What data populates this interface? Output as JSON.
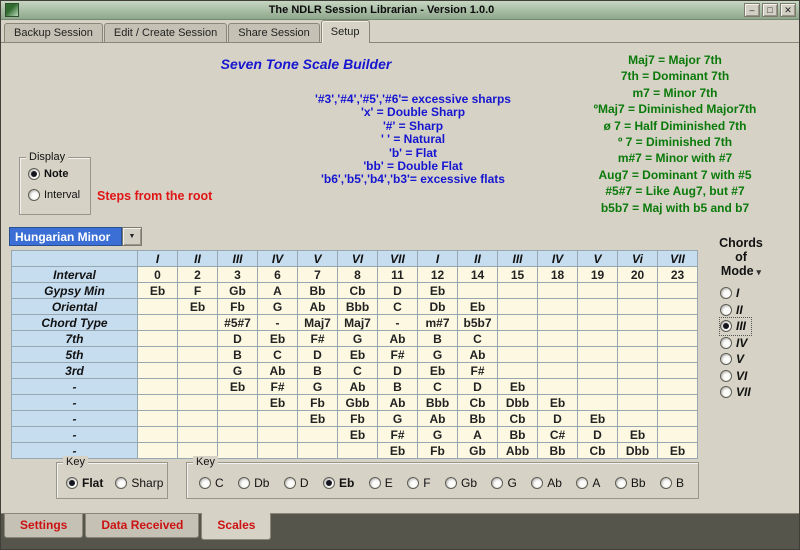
{
  "window": {
    "title": "The NDLR Session Librarian - Version 1.0.0",
    "minimize_glyph": "–",
    "maximize_glyph": "□",
    "close_glyph": "✕"
  },
  "top_tabs": {
    "items": [
      "Backup Session",
      "Edit / Create Session",
      "Share Session",
      "Setup"
    ],
    "active": "Setup"
  },
  "builder": {
    "title": "Seven Tone Scale Builder",
    "steps_label": "Steps from the root"
  },
  "accidental_legend": [
    "'#3','#4','#5','#6'= excessive sharps",
    "'x' = Double Sharp",
    "'#' = Sharp",
    "' ' = Natural",
    "'b' = Flat",
    "'bb' = Double Flat",
    "'b6','b5','b4','b3'= excessive flats"
  ],
  "chord_legend": [
    "Maj7 = Major 7th",
    "7th = Dominant 7th",
    "m7 = Minor 7th",
    "ºMaj7 = Diminished Major7th",
    "ø 7 = Half Diminished 7th",
    "º 7 = Diminished 7th",
    "m#7 = Minor with #7",
    "Aug7 = Dominant 7 with #5",
    "#5#7 = Like Aug7, but #7",
    "b5b7 = Maj with b5 and b7"
  ],
  "display_group": {
    "label": "Display",
    "options": [
      "Note",
      "Interval"
    ],
    "selected": "Note"
  },
  "scale_selector": {
    "value": "Hungarian Minor",
    "arrow": "▼"
  },
  "chords_of_mode": {
    "label_lines": [
      "Chords",
      "of",
      "Mode"
    ],
    "arrow": "▾",
    "options": [
      "I",
      "II",
      "III",
      "IV",
      "V",
      "VI",
      "VII"
    ],
    "selected": "III"
  },
  "scale_table": {
    "columns": [
      "I",
      "II",
      "III",
      "IV",
      "V",
      "VI",
      "VII",
      "I",
      "II",
      "III",
      "IV",
      "V",
      "Vi",
      "VII"
    ],
    "rows": [
      {
        "label": "Interval",
        "kind": "interval",
        "start": 0,
        "cells": [
          "0",
          "2",
          "3",
          "6",
          "7",
          "8",
          "11",
          "12",
          "14",
          "15",
          "18",
          "19",
          "20",
          "23"
        ]
      },
      {
        "label": "Gypsy Min",
        "kind": "scale",
        "start": 0,
        "cells": [
          "Eb",
          "F",
          "Gb",
          "A",
          "Bb",
          "Cb",
          "D",
          "Eb"
        ]
      },
      {
        "label": "Oriental",
        "kind": "scale",
        "start": 1,
        "cells": [
          "Eb",
          "Fb",
          "G",
          "Ab",
          "Bbb",
          "C",
          "Db",
          "Eb"
        ]
      },
      {
        "label": "Chord Type",
        "kind": "chordtype",
        "start": 2,
        "cells": [
          "#5#7",
          "-",
          "Maj7",
          "Maj7",
          "-",
          "m#7",
          "b5b7"
        ]
      },
      {
        "label": "7th",
        "kind": "chordnote",
        "start": 2,
        "cells": [
          "D",
          "Eb",
          "F#",
          "G",
          "Ab",
          "B",
          "C"
        ]
      },
      {
        "label": "5th",
        "kind": "chordnote",
        "start": 2,
        "cells": [
          "B",
          "C",
          "D",
          "Eb",
          "F#",
          "G",
          "Ab"
        ]
      },
      {
        "label": "3rd",
        "kind": "chordnote",
        "start": 2,
        "cells": [
          "G",
          "Ab",
          "B",
          "C",
          "D",
          "Eb",
          "F#"
        ]
      },
      {
        "label": "-",
        "kind": "modesel",
        "start": 2,
        "cells": [
          "Eb",
          "F#",
          "G",
          "Ab",
          "B",
          "C",
          "D",
          "Eb"
        ]
      },
      {
        "label": "-",
        "kind": "mode",
        "start": 3,
        "cells": [
          "Eb",
          "Fb",
          "Gbb",
          "Ab",
          "Bbb",
          "Cb",
          "Dbb",
          "Eb"
        ]
      },
      {
        "label": "-",
        "kind": "mode",
        "start": 4,
        "cells": [
          "Eb",
          "Fb",
          "G",
          "Ab",
          "Bb",
          "Cb",
          "D",
          "Eb"
        ]
      },
      {
        "label": "-",
        "kind": "mode",
        "start": 5,
        "cells": [
          "Eb",
          "F#",
          "G",
          "A",
          "Bb",
          "C#",
          "D",
          "Eb"
        ]
      },
      {
        "label": "-",
        "kind": "mode",
        "start": 6,
        "cells": [
          "Eb",
          "Fb",
          "Gb",
          "Abb",
          "Bb",
          "Cb",
          "Dbb",
          "Eb"
        ]
      }
    ]
  },
  "key_type_group": {
    "label": "Key",
    "options": [
      "Flat",
      "Sharp"
    ],
    "selected": "Flat"
  },
  "key_group": {
    "label": "Key",
    "options": [
      "C",
      "Db",
      "D",
      "Eb",
      "E",
      "F",
      "Gb",
      "G",
      "Ab",
      "A",
      "Bb",
      "B"
    ],
    "selected": "Eb"
  },
  "bottom_tabs": {
    "items": [
      "Settings",
      "Data Received",
      "Scales"
    ],
    "active": "Scales"
  },
  "colors": {
    "title_blue": "#1616d1",
    "legend_green": "#0a7a0a",
    "alert_red": "#e01515",
    "tab_text_red": "#cc1212",
    "table_header_bg": "#c6ddef",
    "table_body_bg": "#fdf8e1",
    "selection_blue": "#3b6fd6",
    "panel_bg": "#d6d2c6",
    "titlebar_green": "#8ea78b"
  }
}
